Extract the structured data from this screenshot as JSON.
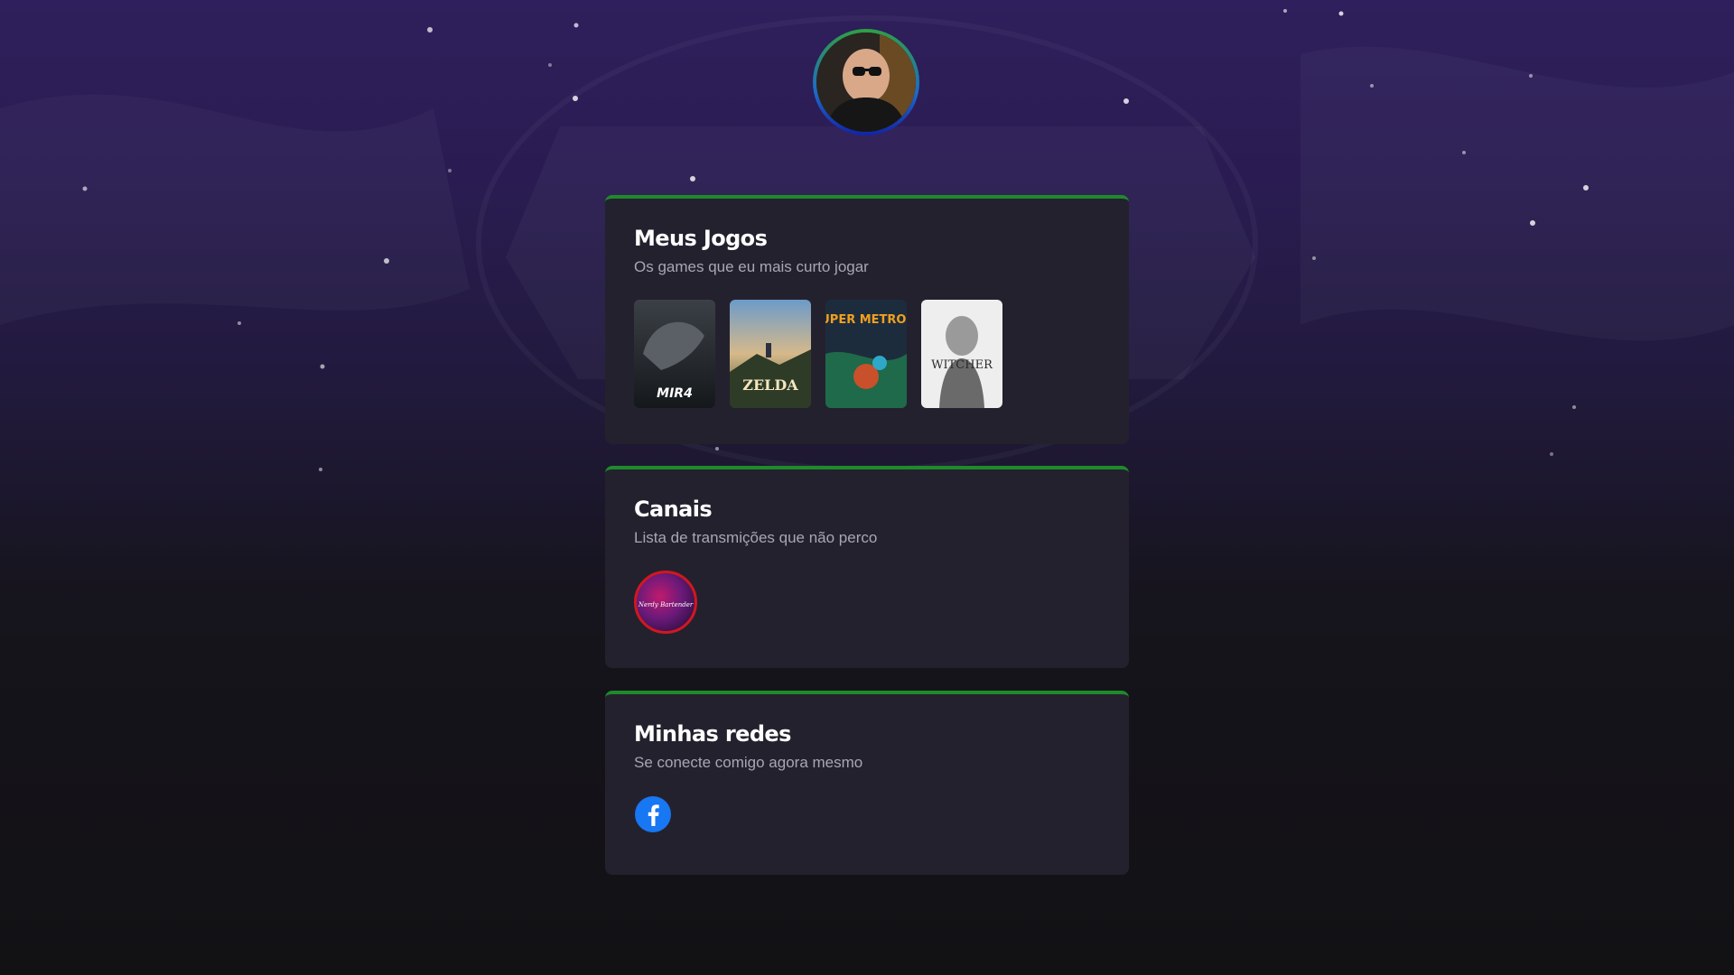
{
  "profile": {
    "avatar_icon": "profile-photo-icon"
  },
  "games_card": {
    "title": "Meus Jogos",
    "subtitle": "Os games que eu mais curto jogar",
    "games": [
      {
        "name": "MIR4",
        "icon": "mir4-cover"
      },
      {
        "name": "ZELDA",
        "icon": "zelda-cover"
      },
      {
        "name": "SUPER METROID",
        "icon": "super-metroid-cover"
      },
      {
        "name": "WITCHER",
        "icon": "witcher-cover"
      }
    ]
  },
  "channels_card": {
    "title": "Canais",
    "subtitle": "Lista de transmições que não perco",
    "channels": [
      {
        "name": "Nerdy Bartender",
        "icon": "nerdy-bartender-logo"
      }
    ]
  },
  "social_card": {
    "title": "Minhas redes",
    "subtitle": "Se conecte comigo agora mesmo",
    "networks": [
      {
        "name": "Facebook",
        "icon": "facebook-icon",
        "color": "#1877f2"
      }
    ]
  },
  "colors": {
    "accent": "#1f8a2c",
    "card_bg": "#24212e",
    "channel_ring": "#d0181f"
  }
}
